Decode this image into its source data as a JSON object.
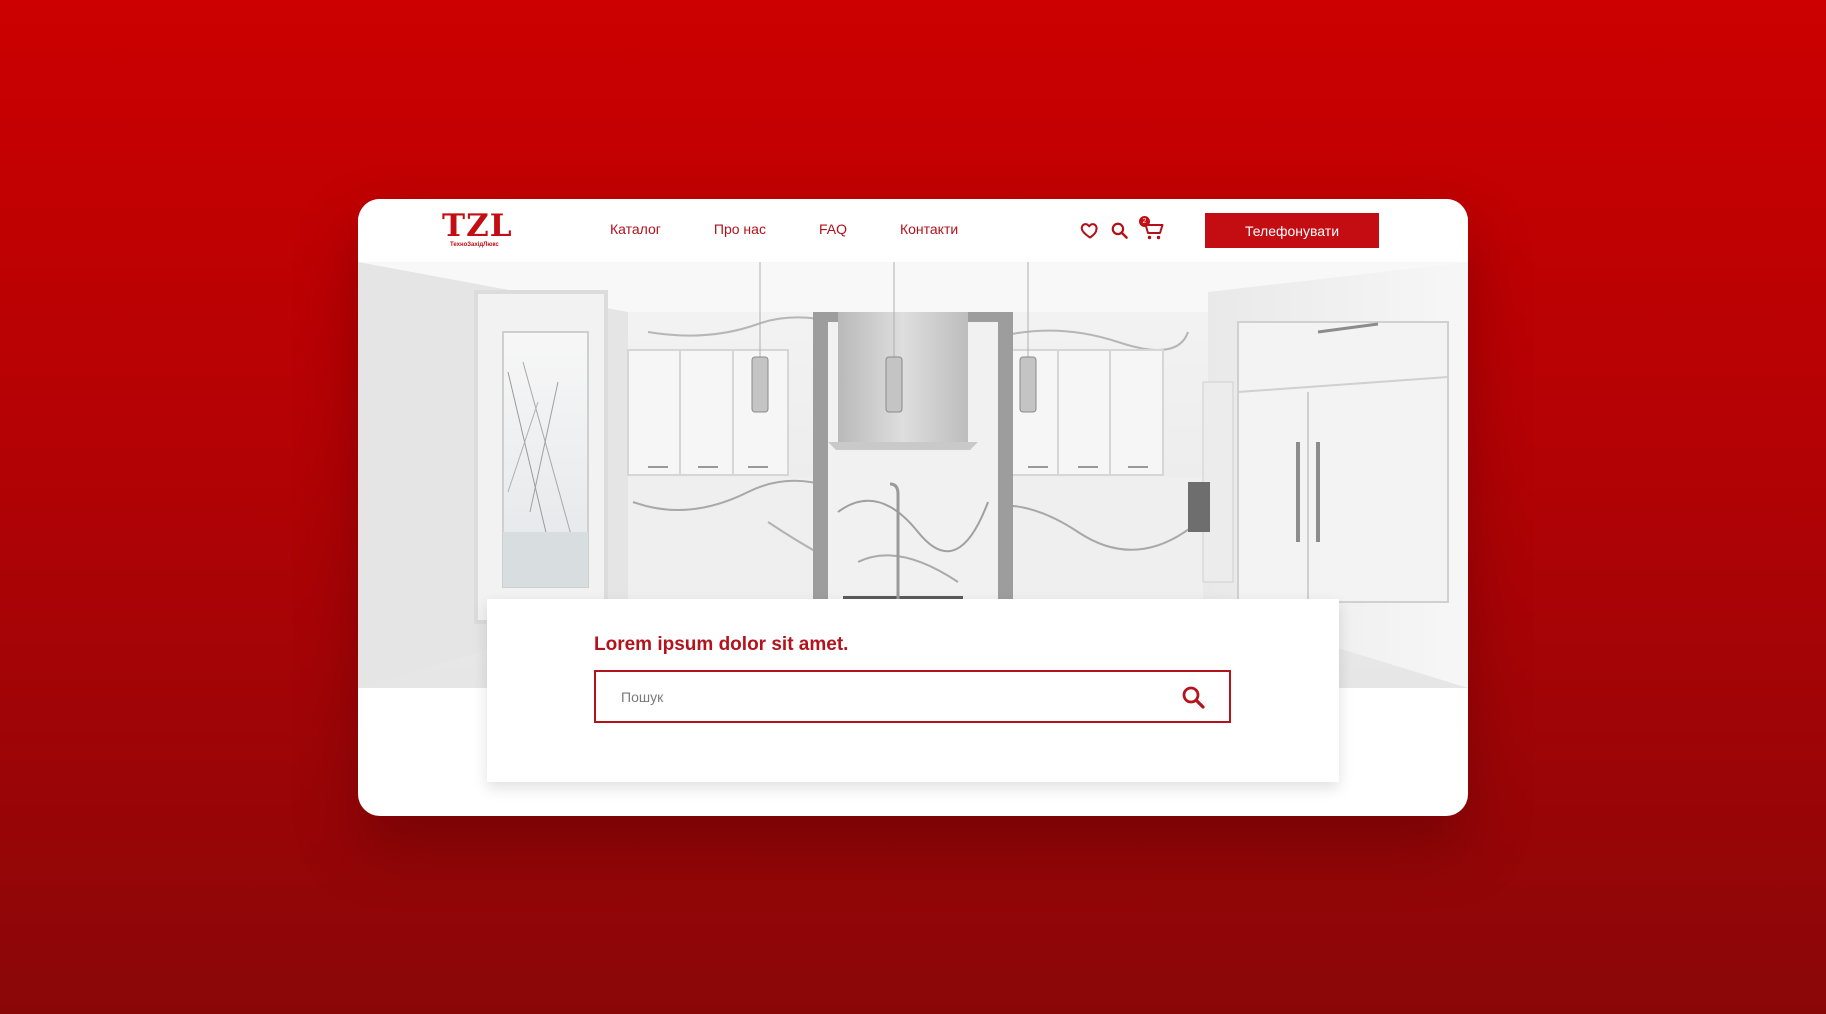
{
  "brand": {
    "logo": "TZL",
    "tagline": "ТехноЗахідЛюкс"
  },
  "nav": {
    "items": [
      {
        "label": "Каталог"
      },
      {
        "label": "Про нас"
      },
      {
        "label": "FAQ"
      },
      {
        "label": "Контакти"
      }
    ]
  },
  "header": {
    "cart_count": "2",
    "call_label": "Телефонувати",
    "icons": [
      "heart-icon",
      "search-icon",
      "cart-icon"
    ]
  },
  "search": {
    "title": "Lorem ipsum dolor sit amet.",
    "placeholder": "Пошук",
    "value": ""
  },
  "colors": {
    "accent": "#c40d12",
    "background_top": "#cc0000",
    "background_bottom": "#8a0708"
  }
}
